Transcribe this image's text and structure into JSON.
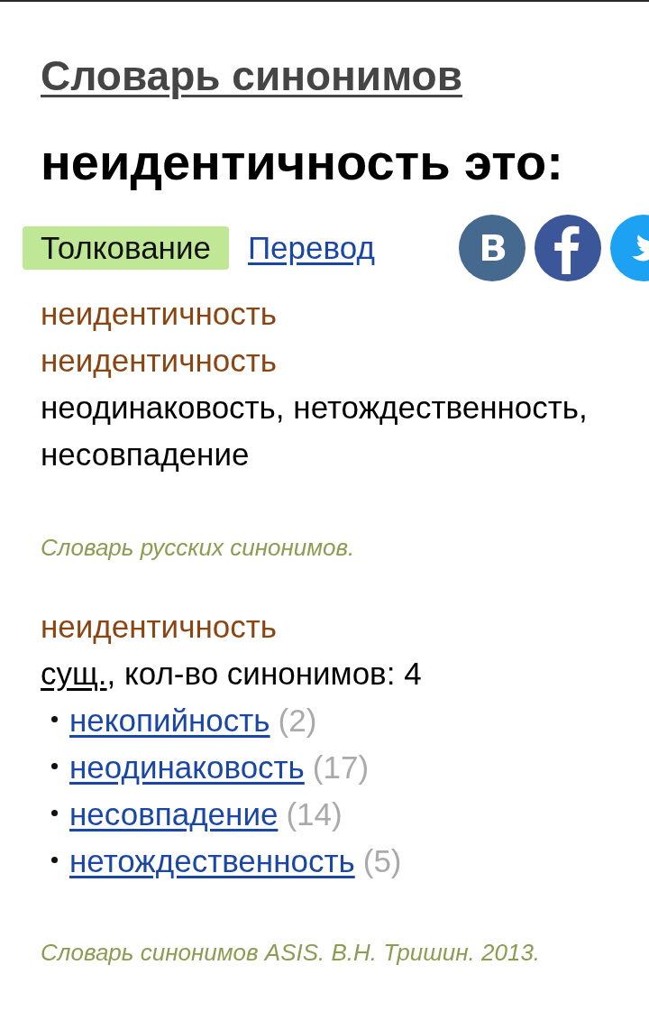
{
  "site_title": "Словарь синонимов",
  "heading": "неидентичность это:",
  "tabs": [
    {
      "label": "Толкование",
      "selected": true
    },
    {
      "label": "Перевод",
      "selected": false
    }
  ],
  "entries": [
    {
      "kind": "definition",
      "headwords": [
        "неидентичность",
        "неидентичность"
      ],
      "definition": "неодинаковость, нетождественность, несовпадение",
      "source": "Словарь русских синонимов."
    },
    {
      "kind": "synonyms",
      "headwords": [
        "неидентичность"
      ],
      "pos": "сущ.",
      "info": ", кол-во синонимов: 4",
      "synonyms": [
        {
          "word": "некопийность",
          "count": "(2)"
        },
        {
          "word": "неодинаковость",
          "count": "(17)"
        },
        {
          "word": "несовпадение",
          "count": "(14)"
        },
        {
          "word": "нетождественность",
          "count": "(5)"
        }
      ],
      "source": "Словарь синонимов ASIS. В.Н. Тришин. 2013."
    }
  ]
}
